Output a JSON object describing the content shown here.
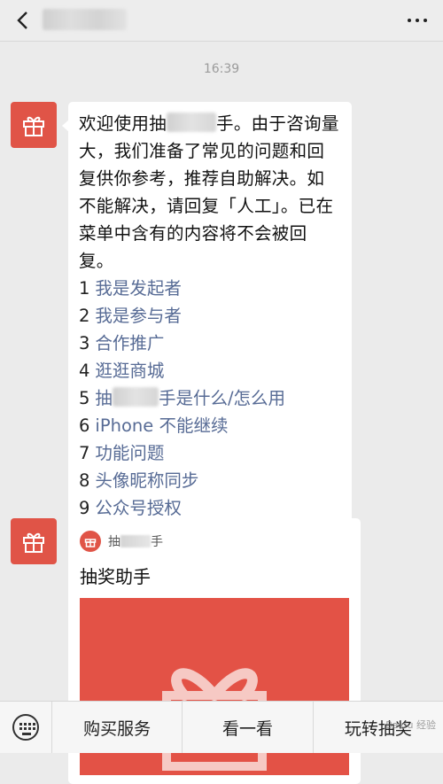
{
  "header": {
    "back_icon": "chevron-left-icon",
    "more_icon": "more-dots-icon"
  },
  "timestamp": "16:39",
  "message1": {
    "intro_part1": "欢迎使用抽",
    "intro_part2": "手。由于咨询量大，我们准备了常见的问题和回复供你参考，推荐自助解决。如不能解决，请回复「人工」。已在菜单中含有的内容将不会被回复。",
    "items": [
      {
        "num": "1",
        "label": "我是发起者"
      },
      {
        "num": "2",
        "label": "我是参与者"
      },
      {
        "num": "3",
        "label": "合作推广"
      },
      {
        "num": "4",
        "label": "逛逛商城"
      },
      {
        "num": "5",
        "label_prefix": "抽",
        "label": "手是什么/怎么用"
      },
      {
        "num": "6",
        "label": "iPhone 不能继续"
      },
      {
        "num": "7",
        "label": "功能问题"
      },
      {
        "num": "8",
        "label": "头像昵称同步"
      },
      {
        "num": "9",
        "label": "公众号授权"
      }
    ]
  },
  "card": {
    "source_prefix": "抽",
    "source_suffix": "手",
    "title": "抽奖助手"
  },
  "bottom_menu": {
    "keyboard_icon": "keyboard-icon",
    "buttons": [
      "购买服务",
      "看一看",
      "玩转抽奖"
    ]
  },
  "watermark": "Baidu 经验",
  "colors": {
    "accent_red": "#e05447",
    "link_blue": "#576b95",
    "background": "#ebebeb"
  }
}
